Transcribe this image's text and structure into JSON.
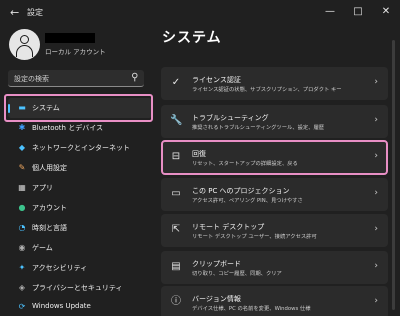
{
  "window": {
    "back_icon": "←",
    "title": "設定",
    "minimize_icon": "—",
    "maximize_icon": "□",
    "close_icon": "✕"
  },
  "account": {
    "name": "",
    "label": "ローカル アカウント"
  },
  "search": {
    "placeholder": "設定の検索",
    "icon": "⚲"
  },
  "sidebar": {
    "items": [
      {
        "label": "システム",
        "icon": "▬",
        "color": "#4cc2ff",
        "active": true
      },
      {
        "label": "Bluetooth とデバイス",
        "icon": "✱",
        "color": "#3fa0ff"
      },
      {
        "label": "ネットワークとインターネット",
        "icon": "◆",
        "color": "#4cc2ff"
      },
      {
        "label": "個人用設定",
        "icon": "✎",
        "color": "#f0a860"
      },
      {
        "label": "アプリ",
        "icon": "▦",
        "color": "#cfcfcf"
      },
      {
        "label": "アカウント",
        "icon": "●",
        "color": "#3cc38c"
      },
      {
        "label": "時刻と言語",
        "icon": "◔",
        "color": "#4cc2ff"
      },
      {
        "label": "ゲーム",
        "icon": "◉",
        "color": "#b0b0b0"
      },
      {
        "label": "アクセシビリティ",
        "icon": "✦",
        "color": "#4cc2ff"
      },
      {
        "label": "プライバシーとセキュリティ",
        "icon": "◈",
        "color": "#b0b0b0"
      },
      {
        "label": "Windows Update",
        "icon": "⟳",
        "color": "#4cc2ff"
      }
    ]
  },
  "main": {
    "title": "システム",
    "cards": [
      {
        "title": "ライセンス認証",
        "subtitle": "ライセンス認証の状態、サブスクリプション、プロダクト キー",
        "icon": "✓"
      },
      {
        "title": "トラブルシューティング",
        "subtitle": "推奨されるトラブルシューティングツール、設定、履歴",
        "icon": "🔧"
      },
      {
        "title": "回復",
        "subtitle": "リセット、スタートアップの詳細設定、戻る",
        "icon": "⊟"
      },
      {
        "title": "この PC へのプロジェクション",
        "subtitle": "アクセス許可、ペアリング PIN、見つけやすさ",
        "icon": "▭"
      },
      {
        "title": "リモート デスクトップ",
        "subtitle": "リモート デスクトップ ユーザー、接続アクセス許可",
        "icon": "⇱"
      },
      {
        "title": "クリップボード",
        "subtitle": "切り取り、コピー履歴、同期、クリア",
        "icon": "▤"
      },
      {
        "title": "バージョン情報",
        "subtitle": "デバイス仕様、PC の名前を変更、Windows 仕様",
        "icon": "ⓘ"
      }
    ],
    "chevron": "›"
  }
}
